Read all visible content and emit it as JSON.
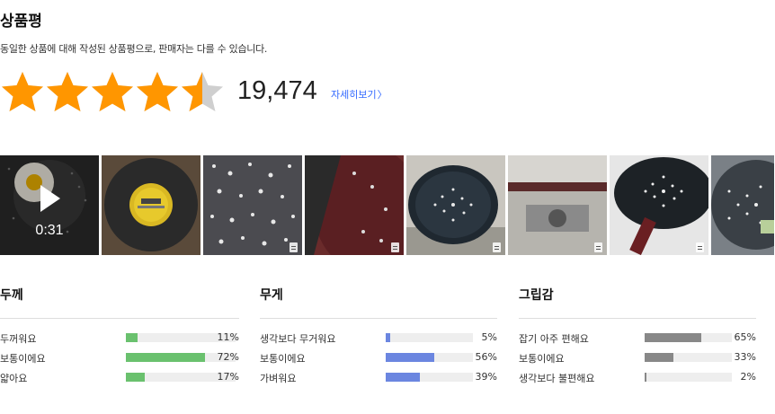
{
  "header": {
    "title": "상품평",
    "subtitle": "동일한 상품에 대해 작성된 상품평으로, 판매자는 다를 수 있습니다."
  },
  "rating": {
    "stars": 4.5,
    "max": 5,
    "count": "19,474",
    "detail_label": "자세히보기",
    "star_color": "#ff9600",
    "empty_star_color": "#cfcfcf"
  },
  "gallery": {
    "video_duration": "0:31",
    "thumbnails": [
      "video",
      "photo",
      "photo",
      "photo",
      "photo",
      "photo",
      "photo",
      "photo"
    ]
  },
  "surveys": [
    {
      "title": "두께",
      "color": "#6ac16e",
      "rows": [
        {
          "label": "두꺼워요",
          "pct": "11%",
          "value": 11
        },
        {
          "label": "보통이에요",
          "pct": "72%",
          "value": 72
        },
        {
          "label": "얇아요",
          "pct": "17%",
          "value": 17
        }
      ]
    },
    {
      "title": "무게",
      "color": "#6b86e0",
      "rows": [
        {
          "label": "생각보다 무거워요",
          "pct": "5%",
          "value": 5
        },
        {
          "label": "보통이에요",
          "pct": "56%",
          "value": 56
        },
        {
          "label": "가벼워요",
          "pct": "39%",
          "value": 39
        }
      ]
    },
    {
      "title": "그립감",
      "color": "#888888",
      "rows": [
        {
          "label": "잡기 아주 편해요",
          "pct": "65%",
          "value": 65
        },
        {
          "label": "보통이에요",
          "pct": "33%",
          "value": 33
        },
        {
          "label": "생각보다 불편해요",
          "pct": "2%",
          "value": 2
        }
      ]
    }
  ]
}
